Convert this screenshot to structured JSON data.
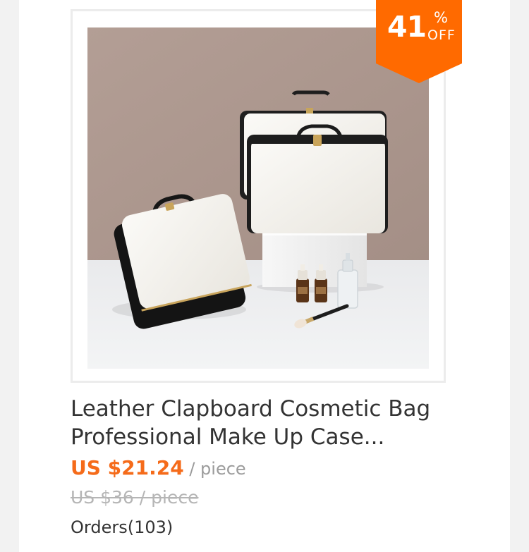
{
  "product": {
    "title": "Leather Clapboard Cosmetic Bag Professional Make Up Case...",
    "price": "US $21.24",
    "price_unit": " / piece",
    "original_price": "US $36 / piece",
    "orders": "Orders(103)",
    "image_icon": "product-photo-cosmetic-bags"
  },
  "badge": {
    "number": "41",
    "percent": "%",
    "off": "OFF",
    "color": "#ff6a00"
  },
  "colors": {
    "price": "#f56b1a",
    "muted": "#9b9b9b",
    "text": "#333333"
  }
}
